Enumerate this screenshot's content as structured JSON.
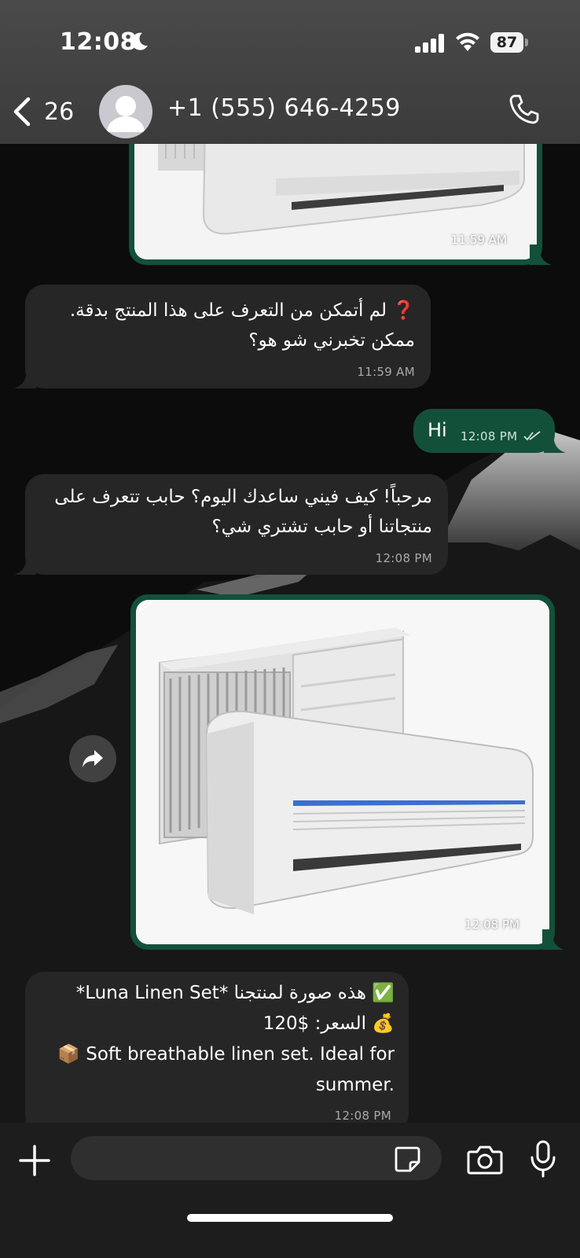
{
  "status": {
    "time": "12:08",
    "battery": "87"
  },
  "header": {
    "back_count": "26",
    "contact": "+1 (555) 646-4259"
  },
  "messages": [
    {
      "type": "image",
      "direction": "out",
      "time": "11:59 AM"
    },
    {
      "type": "text",
      "direction": "in",
      "lines": [
        "❓ لم أتمكن من التعرف على هذا المنتج بدقة.",
        "ممكن تخبرني شو هو؟"
      ],
      "time": "11:59 AM"
    },
    {
      "type": "text",
      "direction": "out",
      "lines": [
        "Hi"
      ],
      "time": "12:08 PM"
    },
    {
      "type": "text",
      "direction": "in",
      "lines": [
        "مرحباً! كيف فيني ساعدك اليوم؟ حابب تتعرف على",
        "منتجاتنا أو حابب تشتري شي؟"
      ],
      "time": "12:08 PM"
    },
    {
      "type": "image",
      "direction": "out",
      "time": "12:08 PM"
    },
    {
      "type": "text",
      "direction": "in",
      "lines": [
        "✅ هذه صورة لمنتجنا *Luna Linen Set*",
        "💰 السعر: $120",
        "📦 Soft breathable linen set. Ideal for",
        "summer."
      ],
      "time": "12:08 PM"
    }
  ],
  "colors": {
    "outgoing_bubble": "#13503a",
    "incoming_bubble": "#262626",
    "header_bg": "#3b3b3b"
  },
  "icons": [
    "moon-icon",
    "signal-icon",
    "wifi-icon",
    "back-chevron-icon",
    "avatar-person-icon",
    "phone-call-icon",
    "forward-arrow-icon",
    "plus-icon",
    "sticker-icon",
    "camera-icon",
    "mic-icon",
    "double-check-icon"
  ]
}
